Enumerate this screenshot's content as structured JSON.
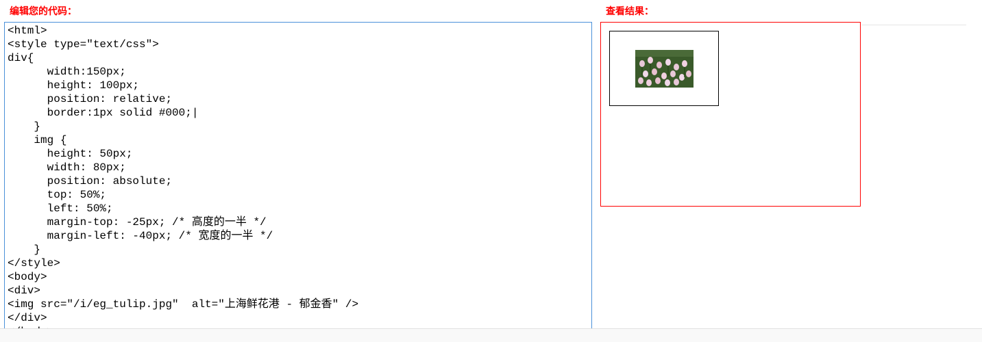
{
  "editor": {
    "title": "编辑您的代码：",
    "code": "<html>\n<style type=\"text/css\">\ndiv{\n      width:150px;\n      height: 100px;\n      position: relative;\n      border:1px solid #000;|\n    }\n    img {\n      height: 50px;\n      width: 80px;\n      position: absolute;\n      top: 50%;\n      left: 50%;\n      margin-top: -25px; /* 高度的一半 */\n      margin-left: -40px; /* 宽度的一半 */\n    }\n</style>\n<body>\n<div>\n<img src=\"/i/eg_tulip.jpg\"  alt=\"上海鲜花港 - 郁金香\" />\n</div>\n</body>\n</html>"
  },
  "result": {
    "title": "查看结果：",
    "img_alt": "上海鲜花港 - 郁金香"
  }
}
